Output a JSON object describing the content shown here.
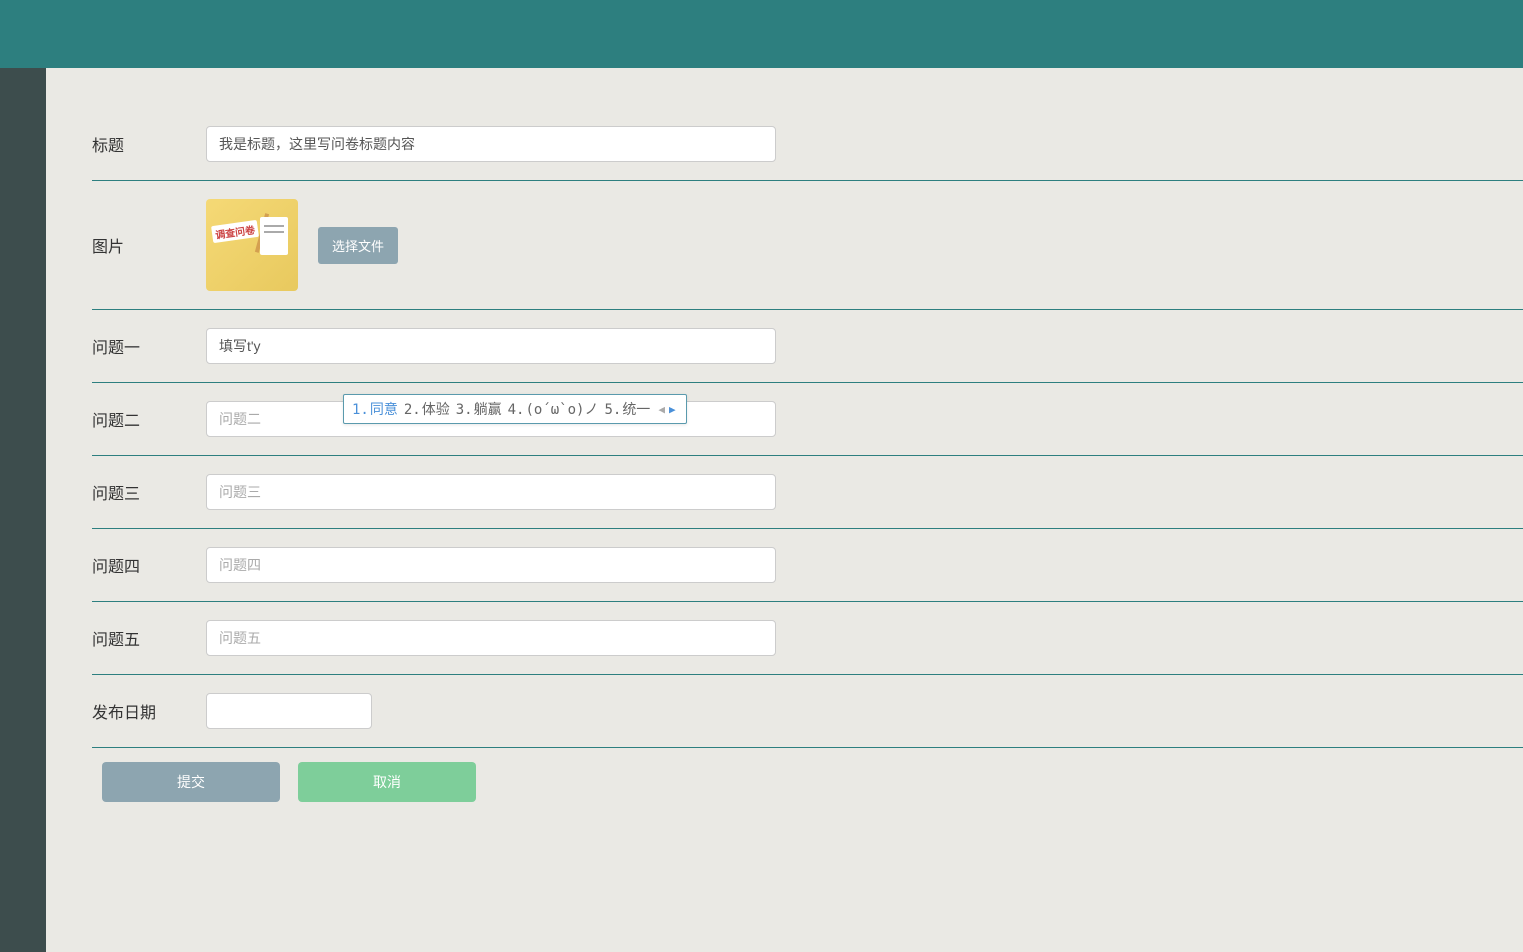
{
  "form": {
    "title": {
      "label": "标题",
      "value": "我是标题，这里写问卷标题内容"
    },
    "image": {
      "label": "图片",
      "button": "选择文件",
      "preview_text": "调查问卷"
    },
    "q1": {
      "label": "问题一",
      "value": "填写t'y"
    },
    "q2": {
      "label": "问题二",
      "placeholder": "问题二"
    },
    "q3": {
      "label": "问题三",
      "placeholder": "问题三"
    },
    "q4": {
      "label": "问题四",
      "placeholder": "问题四"
    },
    "q5": {
      "label": "问题五",
      "placeholder": "问题五"
    },
    "date": {
      "label": "发布日期"
    },
    "submit": "提交",
    "cancel": "取消"
  },
  "ime": {
    "candidates": [
      {
        "num": "1.",
        "text": "同意"
      },
      {
        "num": "2.",
        "text": "体验"
      },
      {
        "num": "3.",
        "text": "躺赢"
      },
      {
        "num": "4.",
        "text": "(o´ω`o)ノ"
      },
      {
        "num": "5.",
        "text": "统一"
      }
    ]
  }
}
